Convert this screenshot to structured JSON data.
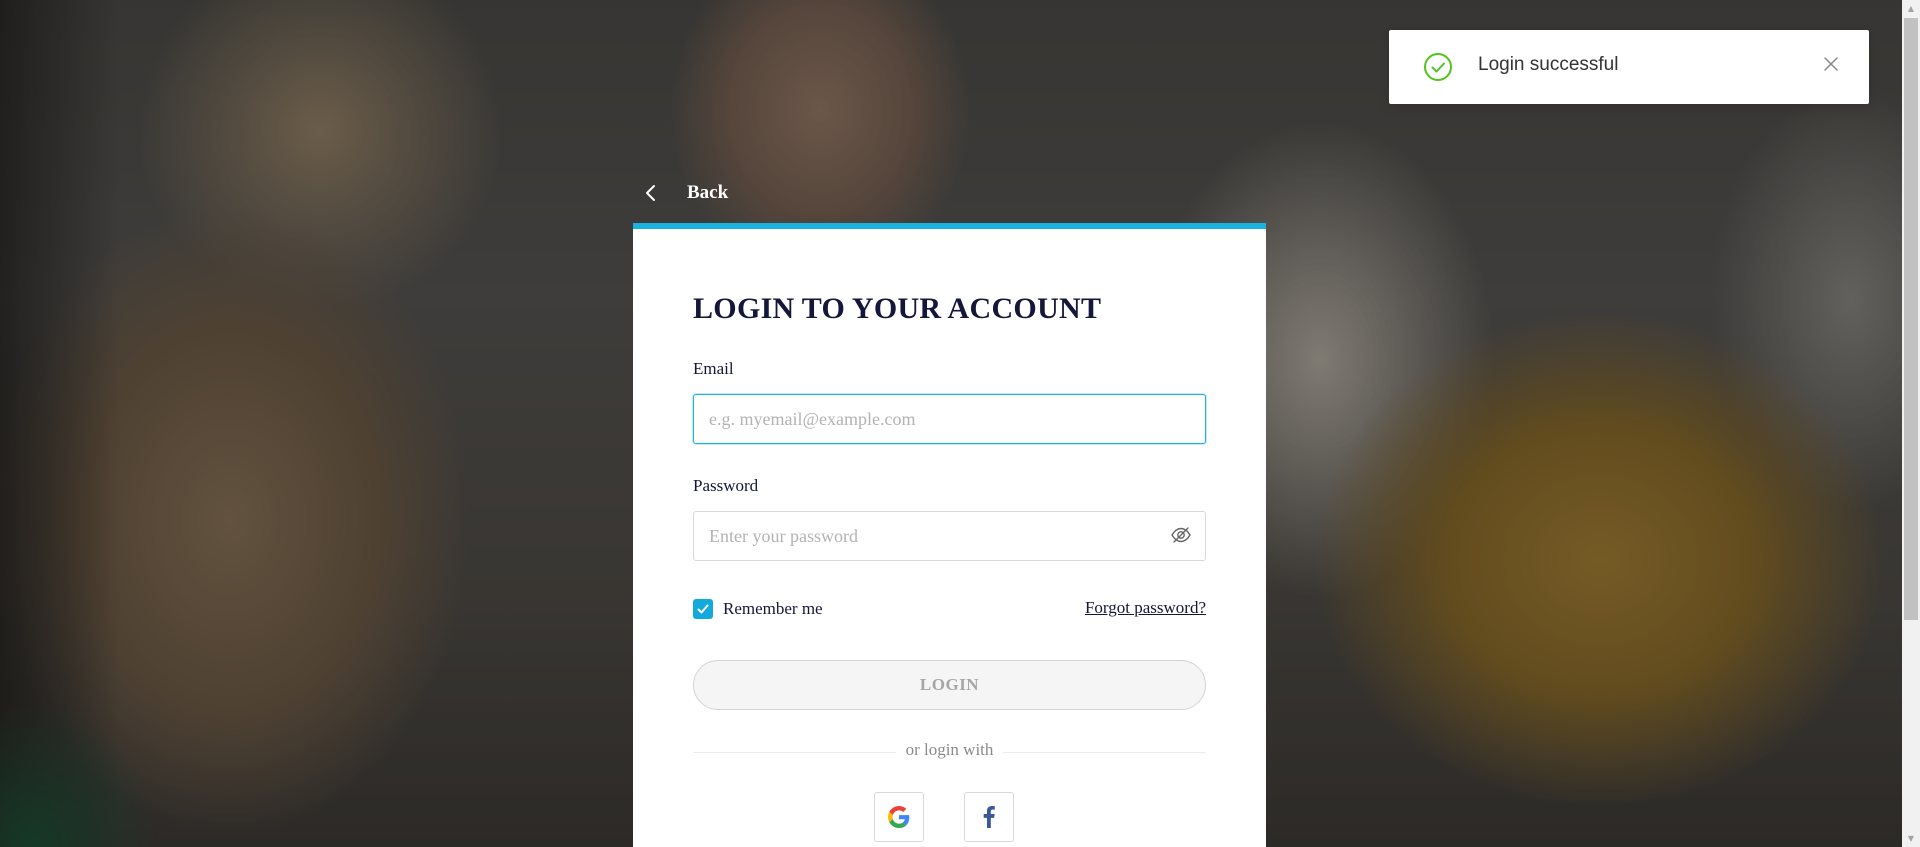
{
  "toast": {
    "message": "Login successful",
    "icon": "check-circle-icon",
    "close_icon": "close-icon",
    "accent": "#52c41a"
  },
  "nav": {
    "back_label": "Back",
    "back_icon": "chevron-left-icon"
  },
  "form": {
    "title": "LOGIN TO YOUR ACCOUNT",
    "email_label": "Email",
    "email_value": "",
    "email_placeholder": "e.g. myemail@example.com",
    "password_label": "Password",
    "password_value": "",
    "password_placeholder": "Enter your password",
    "password_toggle_icon": "eye-off-icon",
    "remember_label": "Remember me",
    "remember_checked": true,
    "forgot_label": "Forgot password?",
    "login_label": "LOGIN",
    "divider_text": "or login with",
    "social": [
      {
        "name": "google",
        "icon": "google-icon"
      },
      {
        "name": "facebook",
        "icon": "facebook-icon"
      }
    ]
  },
  "colors": {
    "accent": "#1ab3e0",
    "title": "#14163a",
    "checkbox": "#12a9dc",
    "facebook": "#3b5998"
  }
}
